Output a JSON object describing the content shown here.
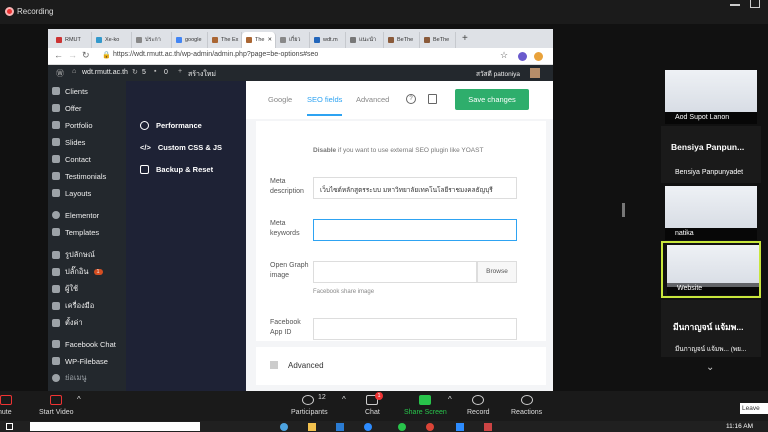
{
  "recording": {
    "label": "Recording"
  },
  "browser": {
    "tabs": [
      "RMUT",
      "Xe-ko",
      "ประกา",
      "google",
      "The Ex",
      "The",
      "เกี่ยว",
      "wdt.m",
      "แนะนำ",
      "BeThe",
      "BeThe"
    ],
    "url": "https://wdt.rmutt.ac.th/wp-admin/admin.php?page=be-options#seo"
  },
  "wp_admin_bar": {
    "site": "wdt.rmutt.ac.th",
    "updates": "5",
    "comments": "0",
    "new": "สร้างใหม่",
    "user": "สวัสดี pattoniya"
  },
  "sidebar": {
    "items": [
      "Clients",
      "Offer",
      "Portfolio",
      "Slides",
      "Contact",
      "Testimonials",
      "Layouts",
      "Elementor",
      "Templates",
      "รูปลักษณ์",
      "ปลั๊กอิน",
      "ผู้ใช้",
      "เครื่องมือ",
      "ตั้งค่า",
      "Facebook Chat",
      "WP-Filebase",
      "ย่อเมนู"
    ],
    "plugin_badge": "1"
  },
  "subnav": {
    "items": [
      "Performance",
      "Custom CSS & JS",
      "Backup & Reset"
    ]
  },
  "seo": {
    "tabs": [
      "Google",
      "SEO fields",
      "Advanced"
    ],
    "save_label": "Save changes",
    "disable_note_bold": "Disable",
    "disable_note": " if you want to use external SEO plugin like YOAST",
    "meta_description_label": "Meta description",
    "meta_description_value": "เว็บไซต์หลักสูตรระบบ มหาวิทยาลัยเทคโนโลยีราชมงคลธัญบุรี",
    "meta_keywords_label": "Meta keywords",
    "meta_keywords_value": "",
    "og_image_label": "Open Graph image",
    "browse_label": "Browse",
    "og_help": "Facebook share image",
    "fb_app_id_label": "Facebook App ID",
    "advanced_label": "Advanced"
  },
  "participants": [
    {
      "name": "Aod Supot Lanon"
    },
    {
      "name": "Bensiya Panpunyadet",
      "card": "Bensiya Panpun..."
    },
    {
      "name": "natika"
    },
    {
      "name": "Website"
    },
    {
      "name": "มีนกาญจน์ แจ้มพ... (พย...",
      "card": "มีนกาญจน์ แจ้มพ..."
    }
  ],
  "zoom_toolbar": {
    "mute": "nute",
    "video": "Start Video",
    "participants": "Participants",
    "participants_count": "12",
    "chat": "Chat",
    "chat_badge": "1",
    "share": "Share Screen",
    "record": "Record",
    "reactions": "Reactions",
    "leave": "Leave"
  },
  "taskbar": {
    "time": "11:16 AM"
  },
  "colors": {
    "accent": "#2ea3f2",
    "save_green": "#2eae6c",
    "share_green": "#28c44b",
    "record_red": "#e33"
  }
}
